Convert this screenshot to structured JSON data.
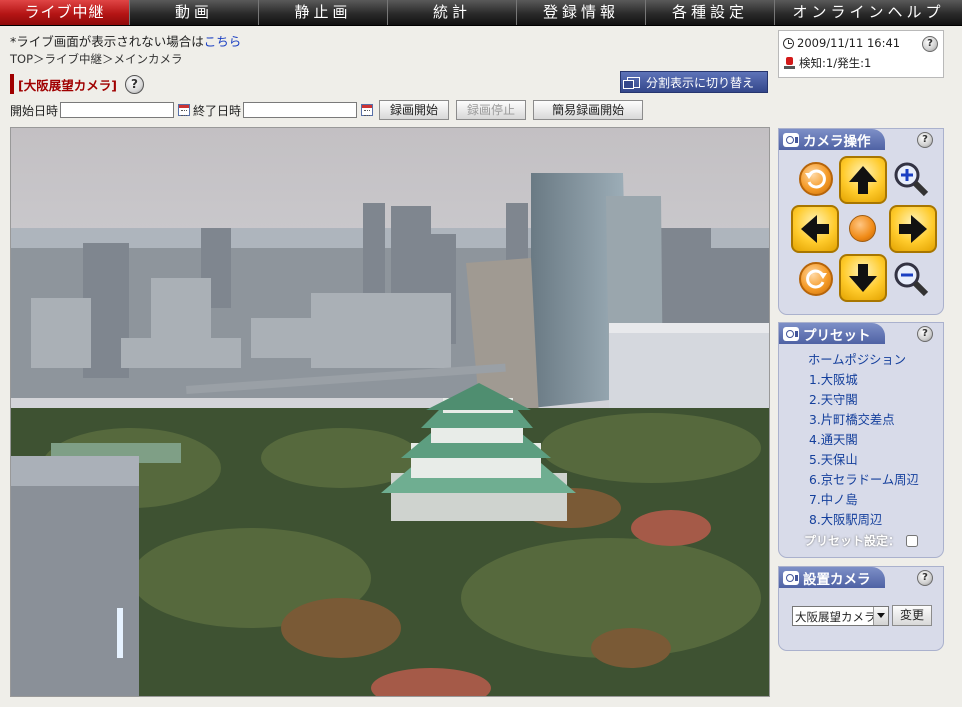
{
  "nav": {
    "items": [
      {
        "label": "ライブ中継",
        "active": true
      },
      {
        "label": "動画",
        "active": false
      },
      {
        "label": "静止画",
        "active": false
      },
      {
        "label": "統計",
        "active": false
      },
      {
        "label": "登録情報",
        "active": false
      },
      {
        "label": "各種設定",
        "active": false
      },
      {
        "label": "オンラインヘルプ",
        "active": false
      }
    ]
  },
  "notice": {
    "text": "*ライブ画面が表示されない場合は",
    "link": "こちら"
  },
  "breadcrumb": "TOP＞ライブ中継＞メインカメラ",
  "status": {
    "datetime": "2009/11/11  16:41",
    "detection": "検知:1/発生:1"
  },
  "camera_title": "[大阪展望カメラ]",
  "split_button": "分割表示に切り替え",
  "recording": {
    "start_label": "開始日時",
    "start_value": "",
    "end_label": "終了日時",
    "end_value": "",
    "record_start": "録画開始",
    "record_stop": "録画停止",
    "simple_record": "簡易録画開始"
  },
  "camera_control": {
    "title": "カメラ操作"
  },
  "preset": {
    "title": "プリセット",
    "items": [
      "ホームポジション",
      "1.大阪城",
      "2.天守閣",
      "3.片町橋交差点",
      "4.通天閣",
      "5.天保山",
      "6.京セラドーム周辺",
      "7.中ノ島",
      "8.大阪駅周辺"
    ],
    "setting_label": "プリセット設定："
  },
  "installed_camera": {
    "title": "設置カメラ",
    "selected": "大阪展望カメラ",
    "change_button": "変更"
  },
  "help_glyph": "?",
  "colors": {
    "nav_active": "#c01d1d",
    "link": "#143f9c",
    "panel_header": "#5d6fb0",
    "camera_title": "#a00000"
  }
}
